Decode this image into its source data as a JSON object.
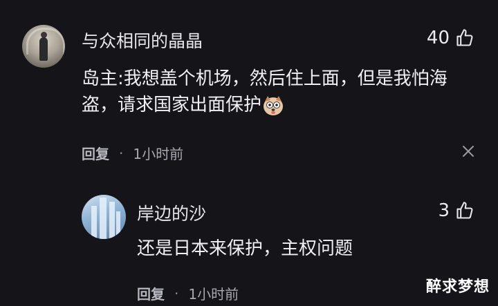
{
  "comment": {
    "username": "与众相同的晶晶",
    "likes": "40",
    "text_line1": "岛主:我想盖个机场，然后住上面，但是我怕海",
    "text_line2": "盗，请求国家出面保护",
    "reply_label": "回复",
    "separator": "·",
    "time": "1小时前"
  },
  "reply": {
    "username": "岸边的沙",
    "likes": "3",
    "text": "还是日本来保护，主权问题",
    "reply_label": "回复",
    "separator": "·",
    "time": "1小时前"
  },
  "watermark": "醉求梦想",
  "icons": {
    "like": "thumbs-up-icon",
    "close": "close-icon",
    "emoji": "dog-emoji-icon"
  }
}
